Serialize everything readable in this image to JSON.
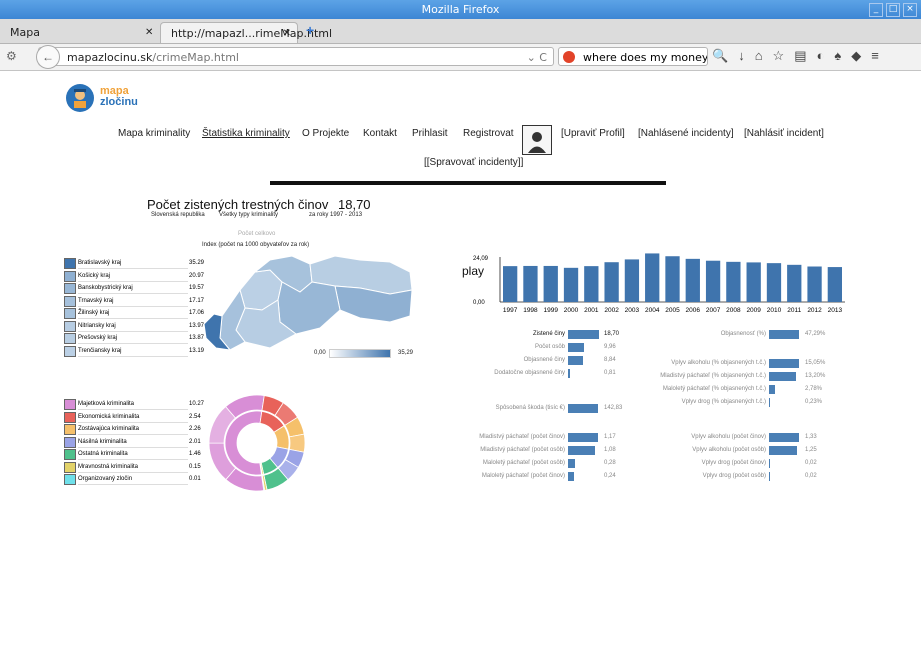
{
  "browser": {
    "window_title": "Mozilla Firefox",
    "tabs": [
      {
        "label": "Mapa"
      },
      {
        "label": "http://mapazl...rimeMap.html"
      }
    ],
    "url_domain": "mapazlocinu.sk",
    "url_path": "/crimeMap.html",
    "search_text": "where does my money go"
  },
  "site": {
    "logo_line1": "mapa",
    "logo_line2": "zločinu",
    "menu": [
      "Mapa kriminality",
      "Štatistika kriminality",
      "O Projekte",
      "Kontakt",
      "Prihlasit",
      "Registrovat",
      "[Upraviť Profil]",
      "[Nahlásené incidenty]",
      "[Nahlásiť incident]",
      "[[Spravovať incidenty]]"
    ]
  },
  "stats": {
    "title": "Počet zistených trestných činov",
    "value": "18,70",
    "filter_region": "Slovenská republika",
    "filter_type": "Všetky typy kriminality",
    "filter_years": "za roky 1997 - 2013",
    "index_title": "Počet celkovo",
    "index_subtitle": "Index (počet na 1000 obyvateľov za rok)",
    "scale_min": "0,00",
    "scale_max": "35,29",
    "play_label": "play"
  },
  "regions": [
    {
      "name": "Bratislavský kraj",
      "value": "35.29",
      "color": "#3f74ad"
    },
    {
      "name": "Košický kraj",
      "value": "20.97",
      "color": "#8fb0d2"
    },
    {
      "name": "Banskobystrický kraj",
      "value": "19.57",
      "color": "#98b7d6"
    },
    {
      "name": "Trnavský kraj",
      "value": "17.17",
      "color": "#a6c1dc"
    },
    {
      "name": "Žilinský kraj",
      "value": "17.06",
      "color": "#a7c2dc"
    },
    {
      "name": "Nitriansky kraj",
      "value": "13.97",
      "color": "#b7cde3"
    },
    {
      "name": "Prešovský kraj",
      "value": "13.87",
      "color": "#b8cee3"
    },
    {
      "name": "Trenčiansky kraj",
      "value": "13.19",
      "color": "#bbd0e5"
    }
  ],
  "crime_types": [
    {
      "name": "Majetková kriminalita",
      "value": "10.27",
      "color": "#d88ed6"
    },
    {
      "name": "Ekonomická kriminalita",
      "value": "2.54",
      "color": "#e8625a"
    },
    {
      "name": "Zostávajúca kriminalita",
      "value": "2.26",
      "color": "#f5c06a"
    },
    {
      "name": "Násilná kriminalita",
      "value": "2.01",
      "color": "#9aa3e6"
    },
    {
      "name": "Ostatná kriminalita",
      "value": "1.46",
      "color": "#4fc18c"
    },
    {
      "name": "Mravnostná kriminalita",
      "value": "0.15",
      "color": "#e3d36a"
    },
    {
      "name": "Organizovaný zločin",
      "value": "0.01",
      "color": "#6fe0ea"
    }
  ],
  "chart_data": {
    "type": "bar",
    "categories": [
      "1997",
      "1998",
      "1999",
      "2000",
      "2001",
      "2002",
      "2003",
      "2004",
      "2005",
      "2006",
      "2007",
      "2008",
      "2009",
      "2010",
      "2011",
      "2012",
      "2013"
    ],
    "values": [
      19.2,
      19.3,
      19.3,
      18.3,
      19.2,
      21.3,
      22.8,
      26.0,
      24.5,
      23.1,
      22.1,
      21.5,
      21.2,
      20.8,
      19.9,
      19.0,
      18.7
    ],
    "ylim": [
      0,
      24.09
    ],
    "ytick_labels": [
      "0,00",
      "24,09"
    ]
  },
  "indicators_left": [
    {
      "label": "Zistené činy",
      "value": "18,70",
      "frac": 0.9,
      "group": 0
    },
    {
      "label": "Počet osôb",
      "value": "9,96",
      "frac": 0.48,
      "group": 0
    },
    {
      "label": "Objasnené činy",
      "value": "8,84",
      "frac": 0.43,
      "group": 0
    },
    {
      "label": "Dodatočne objasnené činy",
      "value": "0,81",
      "frac": 0.05,
      "group": 0
    },
    {
      "label": "Spôsobená škoda (tisíc €)",
      "value": "142,83",
      "frac": 0.87,
      "group": 1
    },
    {
      "label": "Mladistvý páchateľ (počet činov)",
      "value": "1,17",
      "frac": 0.87,
      "group": 2
    },
    {
      "label": "Mladistvý páchateľ (počet osôb)",
      "value": "1,08",
      "frac": 0.8,
      "group": 2
    },
    {
      "label": "Maloletý páchateľ (počet osôb)",
      "value": "0,28",
      "frac": 0.21,
      "group": 2
    },
    {
      "label": "Maloletý páchateľ (počet činov)",
      "value": "0,24",
      "frac": 0.18,
      "group": 2
    }
  ],
  "indicators_right": [
    {
      "label": "Objasnenosť (%)",
      "value": "47,29%",
      "frac": 0.87,
      "group": 0
    },
    {
      "label": "Vplyv alkoholu (% objasnených t.č.)",
      "value": "15,05%",
      "frac": 0.87,
      "group": 1
    },
    {
      "label": "Mladistvý páchateľ (% objasnených t.č.)",
      "value": "13,20%",
      "frac": 0.78,
      "group": 1
    },
    {
      "label": "Maloletý páchateľ (% objasnených t.č.)",
      "value": "2,78%",
      "frac": 0.17,
      "group": 1
    },
    {
      "label": "Vplyv drog (% objasnených t.č.)",
      "value": "0,23%",
      "frac": 0.02,
      "group": 1
    },
    {
      "label": "Vplyv alkoholu (počet činov)",
      "value": "1,33",
      "frac": 0.87,
      "group": 2
    },
    {
      "label": "Vplyv alkoholu (počet osôb)",
      "value": "1,25",
      "frac": 0.82,
      "group": 2
    },
    {
      "label": "Vplyv drog (počet činov)",
      "value": "0,02",
      "frac": 0.01,
      "group": 2
    },
    {
      "label": "Vplyv drog (počet osôb)",
      "value": "0,02",
      "frac": 0.01,
      "group": 2
    }
  ]
}
